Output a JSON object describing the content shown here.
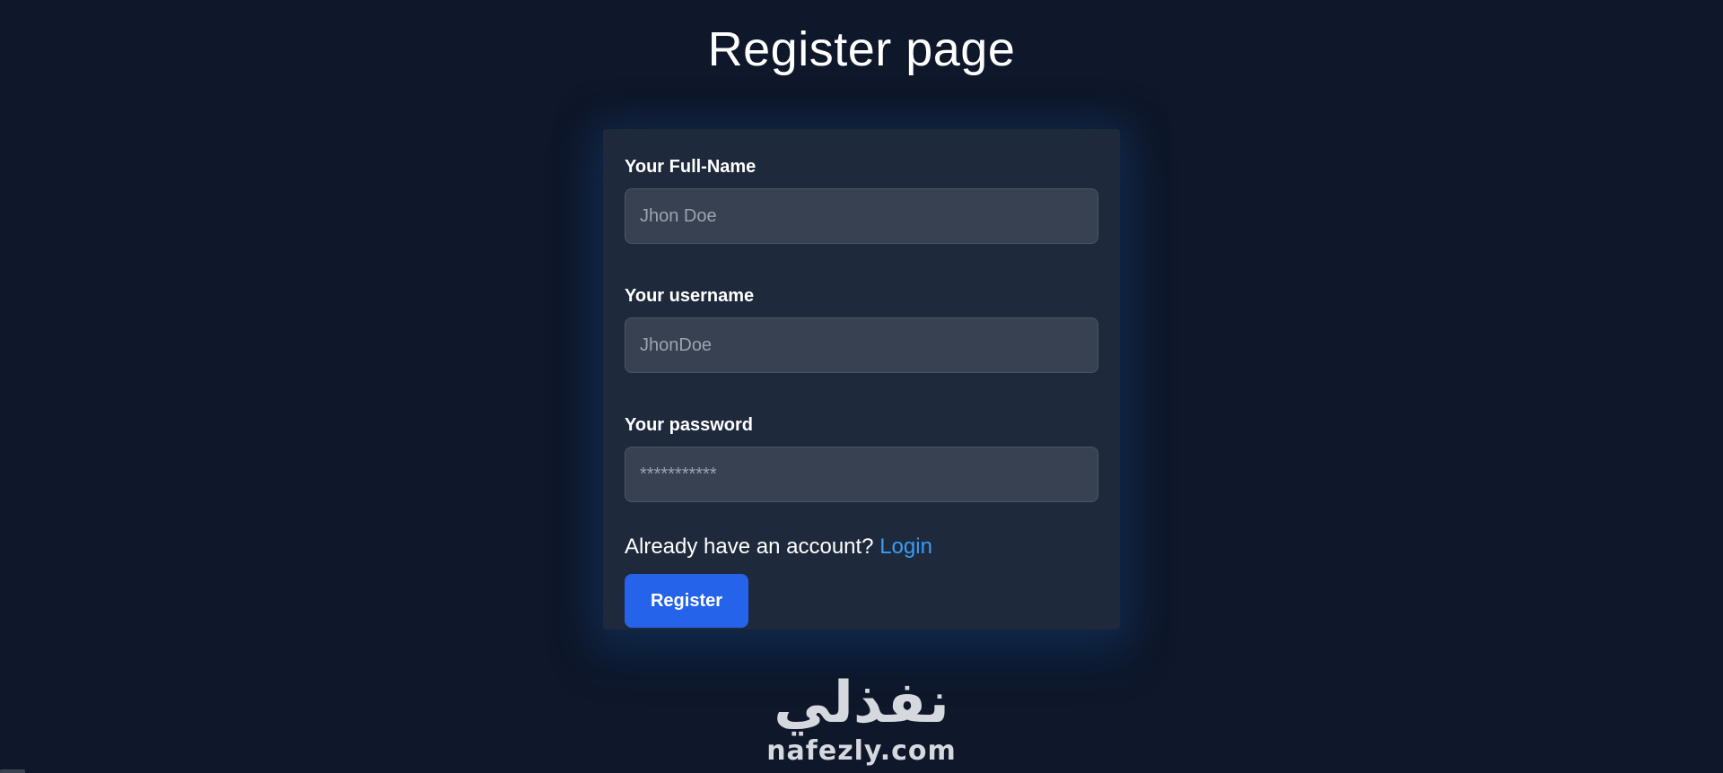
{
  "page": {
    "title": "Register page"
  },
  "form": {
    "fullname": {
      "label": "Your Full-Name",
      "placeholder": "Jhon Doe",
      "value": ""
    },
    "username": {
      "label": "Your username",
      "placeholder": "JhonDoe",
      "value": ""
    },
    "password": {
      "label": "Your password",
      "placeholder": "***********",
      "value": ""
    },
    "account_prompt": "Already have an account?",
    "login_link": "Login",
    "register_button": "Register"
  },
  "brand": {
    "arabic": "نفذلي",
    "latin": "nafezly.com"
  },
  "colors": {
    "background": "#0f172a",
    "card": "#1e293b",
    "input": "#374151",
    "link": "#3b9cf5",
    "button": "#2563eb"
  }
}
